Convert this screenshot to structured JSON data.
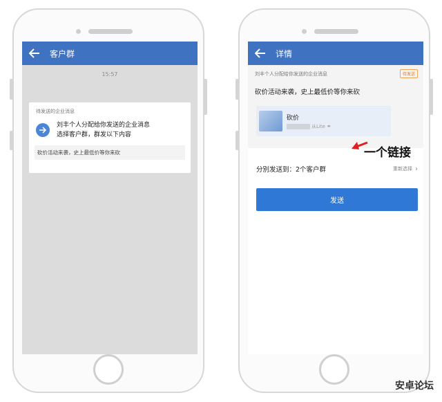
{
  "left_phone": {
    "title": "客户群",
    "time": "15:57",
    "card": {
      "header": "待发送的企业消息",
      "body_line1": "刘丰个人分配给你发送的企业消息",
      "body_line2": "选择客户群，群发以下内容",
      "sub_text": "砍价活动来袭，史上最低价等你来砍"
    }
  },
  "right_phone": {
    "title": "详情",
    "tip": "刘丰个人分配给你发送的企业消息",
    "badge": "待发送",
    "message_title": "砍价活动来袭，史上最低价等你来砍",
    "link": {
      "title": "砍价",
      "subtitle": "从Lite"
    },
    "annotation": "一个链接",
    "distribute_label": "分別发送到：2个客户群",
    "reselect_label": "重新选择",
    "send_label": "发送"
  },
  "watermark": "安卓论坛",
  "colors": {
    "topbar": "#3f73c2",
    "send_button": "#2f78d6",
    "arrow": "#e02020"
  },
  "icons": [
    "back-arrow-icon",
    "circle-arrow-icon",
    "chain-link-icon",
    "chevron-right-icon",
    "red-arrow-icon"
  ]
}
